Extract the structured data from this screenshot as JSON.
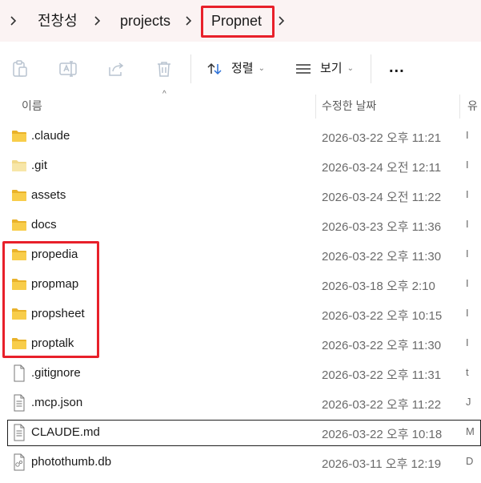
{
  "breadcrumb": {
    "items": [
      "전창성",
      "projects",
      "Propnet"
    ]
  },
  "toolbar": {
    "sort_label": "정렬",
    "view_label": "보기",
    "more_label": "..."
  },
  "columns": {
    "name": "이름",
    "modified": "수정한 날짜",
    "type": "유"
  },
  "files": [
    {
      "name": ".claude",
      "date": "2026-03-22 오후 11:21",
      "type": "I",
      "kind": "folder"
    },
    {
      "name": ".git",
      "date": "2026-03-24 오전 12:11",
      "type": "I",
      "kind": "folder-light"
    },
    {
      "name": "assets",
      "date": "2026-03-24 오전 11:22",
      "type": "I",
      "kind": "folder"
    },
    {
      "name": "docs",
      "date": "2026-03-23 오후 11:36",
      "type": "I",
      "kind": "folder"
    },
    {
      "name": "propedia",
      "date": "2026-03-22 오후 11:30",
      "type": "I",
      "kind": "folder"
    },
    {
      "name": "propmap",
      "date": "2026-03-18 오후 2:10",
      "type": "I",
      "kind": "folder"
    },
    {
      "name": "propsheet",
      "date": "2026-03-22 오후 10:15",
      "type": "I",
      "kind": "folder"
    },
    {
      "name": "proptalk",
      "date": "2026-03-22 오후 11:30",
      "type": "I",
      "kind": "folder"
    },
    {
      "name": ".gitignore",
      "date": "2026-03-22 오후 11:31",
      "type": "t",
      "kind": "file"
    },
    {
      "name": ".mcp.json",
      "date": "2026-03-22 오후 11:22",
      "type": "J",
      "kind": "file-lines"
    },
    {
      "name": "CLAUDE.md",
      "date": "2026-03-22 오후 10:18",
      "type": "M",
      "kind": "file-lines",
      "selected": true
    },
    {
      "name": "photothumb.db",
      "date": "2026-03-11 오후 12:19",
      "type": "D",
      "kind": "file-db"
    }
  ],
  "colors": {
    "highlight": "#e8202a",
    "folder": "#f5c842",
    "breadcrumb_bg": "#fbf3f3"
  }
}
